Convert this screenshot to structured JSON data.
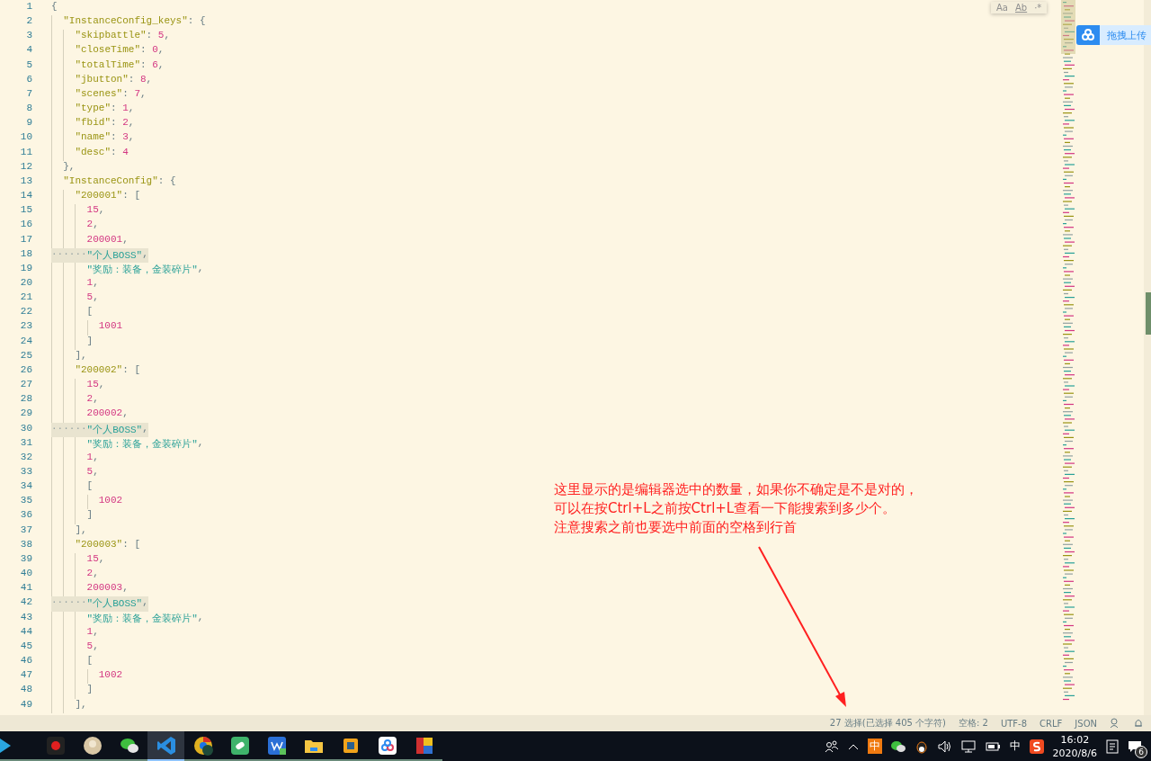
{
  "editor": {
    "lines": [
      {
        "number": "1",
        "selected": false,
        "tokens": [
          {
            "kind": "punct",
            "text": "{"
          }
        ],
        "children": [
          {
            "number": "2",
            "selected": false,
            "tokens": [
              {
                "kind": "key",
                "text": "\"InstanceConfig_keys\""
              },
              {
                "kind": "punct",
                "text": ": {"
              }
            ],
            "children": [
              {
                "number": "3",
                "selected": false,
                "tokens": [
                  {
                    "kind": "key",
                    "text": "\"skipbattle\""
                  },
                  {
                    "kind": "punct",
                    "text": ": "
                  },
                  {
                    "kind": "number",
                    "text": "5"
                  },
                  {
                    "kind": "punct",
                    "text": ","
                  }
                ]
              },
              {
                "number": "4",
                "selected": false,
                "tokens": [
                  {
                    "kind": "key",
                    "text": "\"closeTime\""
                  },
                  {
                    "kind": "punct",
                    "text": ": "
                  },
                  {
                    "kind": "number",
                    "text": "0"
                  },
                  {
                    "kind": "punct",
                    "text": ","
                  }
                ]
              },
              {
                "number": "5",
                "selected": false,
                "tokens": [
                  {
                    "kind": "key",
                    "text": "\"totalTime\""
                  },
                  {
                    "kind": "punct",
                    "text": ": "
                  },
                  {
                    "kind": "number",
                    "text": "6"
                  },
                  {
                    "kind": "punct",
                    "text": ","
                  }
                ]
              },
              {
                "number": "6",
                "selected": false,
                "tokens": [
                  {
                    "kind": "key",
                    "text": "\"jbutton\""
                  },
                  {
                    "kind": "punct",
                    "text": ": "
                  },
                  {
                    "kind": "number",
                    "text": "8"
                  },
                  {
                    "kind": "punct",
                    "text": ","
                  }
                ]
              },
              {
                "number": "7",
                "selected": false,
                "tokens": [
                  {
                    "kind": "key",
                    "text": "\"scenes\""
                  },
                  {
                    "kind": "punct",
                    "text": ": "
                  },
                  {
                    "kind": "number",
                    "text": "7"
                  },
                  {
                    "kind": "punct",
                    "text": ","
                  }
                ]
              },
              {
                "number": "8",
                "selected": false,
                "tokens": [
                  {
                    "kind": "key",
                    "text": "\"type\""
                  },
                  {
                    "kind": "punct",
                    "text": ": "
                  },
                  {
                    "kind": "number",
                    "text": "1"
                  },
                  {
                    "kind": "punct",
                    "text": ","
                  }
                ]
              },
              {
                "number": "9",
                "selected": false,
                "tokens": [
                  {
                    "kind": "key",
                    "text": "\"fbid\""
                  },
                  {
                    "kind": "punct",
                    "text": ": "
                  },
                  {
                    "kind": "number",
                    "text": "2"
                  },
                  {
                    "kind": "punct",
                    "text": ","
                  }
                ]
              },
              {
                "number": "10",
                "selected": false,
                "tokens": [
                  {
                    "kind": "key",
                    "text": "\"name\""
                  },
                  {
                    "kind": "punct",
                    "text": ": "
                  },
                  {
                    "kind": "number",
                    "text": "3"
                  },
                  {
                    "kind": "punct",
                    "text": ","
                  }
                ]
              },
              {
                "number": "11",
                "selected": false,
                "tokens": [
                  {
                    "kind": "key",
                    "text": "\"desc\""
                  },
                  {
                    "kind": "punct",
                    "text": ": "
                  },
                  {
                    "kind": "number",
                    "text": "4"
                  }
                ]
              }
            ]
          },
          {
            "number": "12",
            "selected": false,
            "tokens": [
              {
                "kind": "punct",
                "text": "},"
              }
            ]
          },
          {
            "number": "13",
            "selected": false,
            "tokens": [
              {
                "kind": "key",
                "text": "\"InstanceConfig\""
              },
              {
                "kind": "punct",
                "text": ": {"
              }
            ],
            "children": [
              {
                "number": "14",
                "selected": false,
                "tokens": [
                  {
                    "kind": "key",
                    "text": "\"200001\""
                  },
                  {
                    "kind": "punct",
                    "text": ": ["
                  }
                ],
                "children": [
                  {
                    "number": "15",
                    "selected": false,
                    "tokens": [
                      {
                        "kind": "number",
                        "text": "15"
                      },
                      {
                        "kind": "punct",
                        "text": ","
                      }
                    ]
                  },
                  {
                    "number": "16",
                    "selected": false,
                    "tokens": [
                      {
                        "kind": "number",
                        "text": "2"
                      },
                      {
                        "kind": "punct",
                        "text": ","
                      }
                    ]
                  },
                  {
                    "number": "17",
                    "selected": false,
                    "tokens": [
                      {
                        "kind": "number",
                        "text": "200001"
                      },
                      {
                        "kind": "punct",
                        "text": ","
                      }
                    ]
                  },
                  {
                    "number": "18",
                    "selected": true,
                    "tokens": [
                      {
                        "kind": "whitespace",
                        "text": "······"
                      },
                      {
                        "kind": "string",
                        "text": "\"个人BOSS\""
                      },
                      {
                        "kind": "punct",
                        "text": ","
                      }
                    ]
                  },
                  {
                    "number": "19",
                    "selected": false,
                    "tokens": [
                      {
                        "kind": "string",
                        "text": "\"奖励：装备，金装碎片\""
                      },
                      {
                        "kind": "punct",
                        "text": ","
                      }
                    ]
                  },
                  {
                    "number": "20",
                    "selected": false,
                    "tokens": [
                      {
                        "kind": "number",
                        "text": "1"
                      },
                      {
                        "kind": "punct",
                        "text": ","
                      }
                    ]
                  },
                  {
                    "number": "21",
                    "selected": false,
                    "tokens": [
                      {
                        "kind": "number",
                        "text": "5"
                      },
                      {
                        "kind": "punct",
                        "text": ","
                      }
                    ]
                  },
                  {
                    "number": "22",
                    "selected": false,
                    "tokens": [
                      {
                        "kind": "punct",
                        "text": "["
                      }
                    ],
                    "children": [
                      {
                        "number": "23",
                        "selected": false,
                        "tokens": [
                          {
                            "kind": "number",
                            "text": "1001"
                          }
                        ]
                      }
                    ]
                  },
                  {
                    "number": "24",
                    "selected": false,
                    "tokens": [
                      {
                        "kind": "punct",
                        "text": "]"
                      }
                    ]
                  }
                ]
              },
              {
                "number": "25",
                "selected": false,
                "tokens": [
                  {
                    "kind": "punct",
                    "text": "],"
                  }
                ]
              },
              {
                "number": "26",
                "selected": false,
                "tokens": [
                  {
                    "kind": "key",
                    "text": "\"200002\""
                  },
                  {
                    "kind": "punct",
                    "text": ": ["
                  }
                ],
                "children": [
                  {
                    "number": "27",
                    "selected": false,
                    "tokens": [
                      {
                        "kind": "number",
                        "text": "15"
                      },
                      {
                        "kind": "punct",
                        "text": ","
                      }
                    ]
                  },
                  {
                    "number": "28",
                    "selected": false,
                    "tokens": [
                      {
                        "kind": "number",
                        "text": "2"
                      },
                      {
                        "kind": "punct",
                        "text": ","
                      }
                    ]
                  },
                  {
                    "number": "29",
                    "selected": false,
                    "tokens": [
                      {
                        "kind": "number",
                        "text": "200002"
                      },
                      {
                        "kind": "punct",
                        "text": ","
                      }
                    ]
                  },
                  {
                    "number": "30",
                    "selected": true,
                    "tokens": [
                      {
                        "kind": "whitespace",
                        "text": "······"
                      },
                      {
                        "kind": "string",
                        "text": "\"个人BOSS\""
                      },
                      {
                        "kind": "punct",
                        "text": ","
                      }
                    ]
                  },
                  {
                    "number": "31",
                    "selected": false,
                    "tokens": [
                      {
                        "kind": "string",
                        "text": "\"奖励：装备，金装碎片\""
                      },
                      {
                        "kind": "punct",
                        "text": ","
                      }
                    ]
                  },
                  {
                    "number": "32",
                    "selected": false,
                    "tokens": [
                      {
                        "kind": "number",
                        "text": "1"
                      },
                      {
                        "kind": "punct",
                        "text": ","
                      }
                    ]
                  },
                  {
                    "number": "33",
                    "selected": false,
                    "tokens": [
                      {
                        "kind": "number",
                        "text": "5"
                      },
                      {
                        "kind": "punct",
                        "text": ","
                      }
                    ]
                  },
                  {
                    "number": "34",
                    "selected": false,
                    "tokens": [
                      {
                        "kind": "punct",
                        "text": "["
                      }
                    ],
                    "children": [
                      {
                        "number": "35",
                        "selected": false,
                        "tokens": [
                          {
                            "kind": "number",
                            "text": "1002"
                          }
                        ]
                      }
                    ]
                  },
                  {
                    "number": "36",
                    "selected": false,
                    "tokens": [
                      {
                        "kind": "punct",
                        "text": "]"
                      }
                    ]
                  }
                ]
              },
              {
                "number": "37",
                "selected": false,
                "tokens": [
                  {
                    "kind": "punct",
                    "text": "],"
                  }
                ]
              },
              {
                "number": "38",
                "selected": false,
                "tokens": [
                  {
                    "kind": "key",
                    "text": "\"200003\""
                  },
                  {
                    "kind": "punct",
                    "text": ": ["
                  }
                ],
                "children": [
                  {
                    "number": "39",
                    "selected": false,
                    "tokens": [
                      {
                        "kind": "number",
                        "text": "15"
                      },
                      {
                        "kind": "punct",
                        "text": ","
                      }
                    ]
                  },
                  {
                    "number": "40",
                    "selected": false,
                    "tokens": [
                      {
                        "kind": "number",
                        "text": "2"
                      },
                      {
                        "kind": "punct",
                        "text": ","
                      }
                    ]
                  },
                  {
                    "number": "41",
                    "selected": false,
                    "tokens": [
                      {
                        "kind": "number",
                        "text": "200003"
                      },
                      {
                        "kind": "punct",
                        "text": ","
                      }
                    ]
                  },
                  {
                    "number": "42",
                    "selected": true,
                    "tokens": [
                      {
                        "kind": "whitespace",
                        "text": "······"
                      },
                      {
                        "kind": "string",
                        "text": "\"个人BOSS\""
                      },
                      {
                        "kind": "punct",
                        "text": ","
                      }
                    ]
                  },
                  {
                    "number": "43",
                    "selected": false,
                    "tokens": [
                      {
                        "kind": "string",
                        "text": "\"奖励：装备，金装碎片\""
                      },
                      {
                        "kind": "punct",
                        "text": ","
                      }
                    ]
                  },
                  {
                    "number": "44",
                    "selected": false,
                    "tokens": [
                      {
                        "kind": "number",
                        "text": "1"
                      },
                      {
                        "kind": "punct",
                        "text": ","
                      }
                    ]
                  },
                  {
                    "number": "45",
                    "selected": false,
                    "tokens": [
                      {
                        "kind": "number",
                        "text": "5"
                      },
                      {
                        "kind": "punct",
                        "text": ","
                      }
                    ]
                  },
                  {
                    "number": "46",
                    "selected": false,
                    "tokens": [
                      {
                        "kind": "punct",
                        "text": "["
                      }
                    ],
                    "children": [
                      {
                        "number": "47",
                        "selected": false,
                        "tokens": [
                          {
                            "kind": "number",
                            "text": "1002"
                          }
                        ]
                      }
                    ]
                  },
                  {
                    "number": "48",
                    "selected": false,
                    "tokens": [
                      {
                        "kind": "punct",
                        "text": "]"
                      }
                    ]
                  }
                ]
              },
              {
                "number": "49",
                "selected": false,
                "tokens": [
                  {
                    "kind": "punct",
                    "text": "],"
                  }
                ]
              }
            ]
          }
        ]
      }
    ]
  },
  "find_widget": {
    "options": [
      "Aa",
      "Ab",
      "·*"
    ]
  },
  "upload_button": {
    "label": "拖拽上传"
  },
  "annotation": {
    "lines": [
      "这里显示的是编辑器选中的数量，如果你不确定是不是对的，",
      "可以在按Ctrl+L之前按Ctrl+L查看一下能搜索到多少个。",
      "注意搜索之前也要选中前面的空格到行首"
    ]
  },
  "status_bar": {
    "items": [
      "27 选择(已选择 405 个字符)",
      "空格: 2",
      "UTF-8",
      "CRLF",
      "JSON"
    ]
  },
  "taskbar": {
    "apps": [
      {
        "kind": "play",
        "selected": false
      },
      {
        "kind": "recorder",
        "selected": false
      },
      {
        "kind": "avatar",
        "selected": false
      },
      {
        "kind": "chat",
        "selected": false
      },
      {
        "kind": "code",
        "selected": true
      },
      {
        "kind": "browser",
        "selected": false
      },
      {
        "kind": "note",
        "selected": false
      },
      {
        "kind": "office",
        "selected": false
      },
      {
        "kind": "folder",
        "selected": false
      },
      {
        "kind": "box",
        "selected": false
      },
      {
        "kind": "cloud",
        "selected": false
      },
      {
        "kind": "tiles",
        "selected": false
      }
    ],
    "ime_badge": "中",
    "ime": "中",
    "time": "16:02",
    "date": "2020/8/6",
    "notification_count": "6"
  }
}
